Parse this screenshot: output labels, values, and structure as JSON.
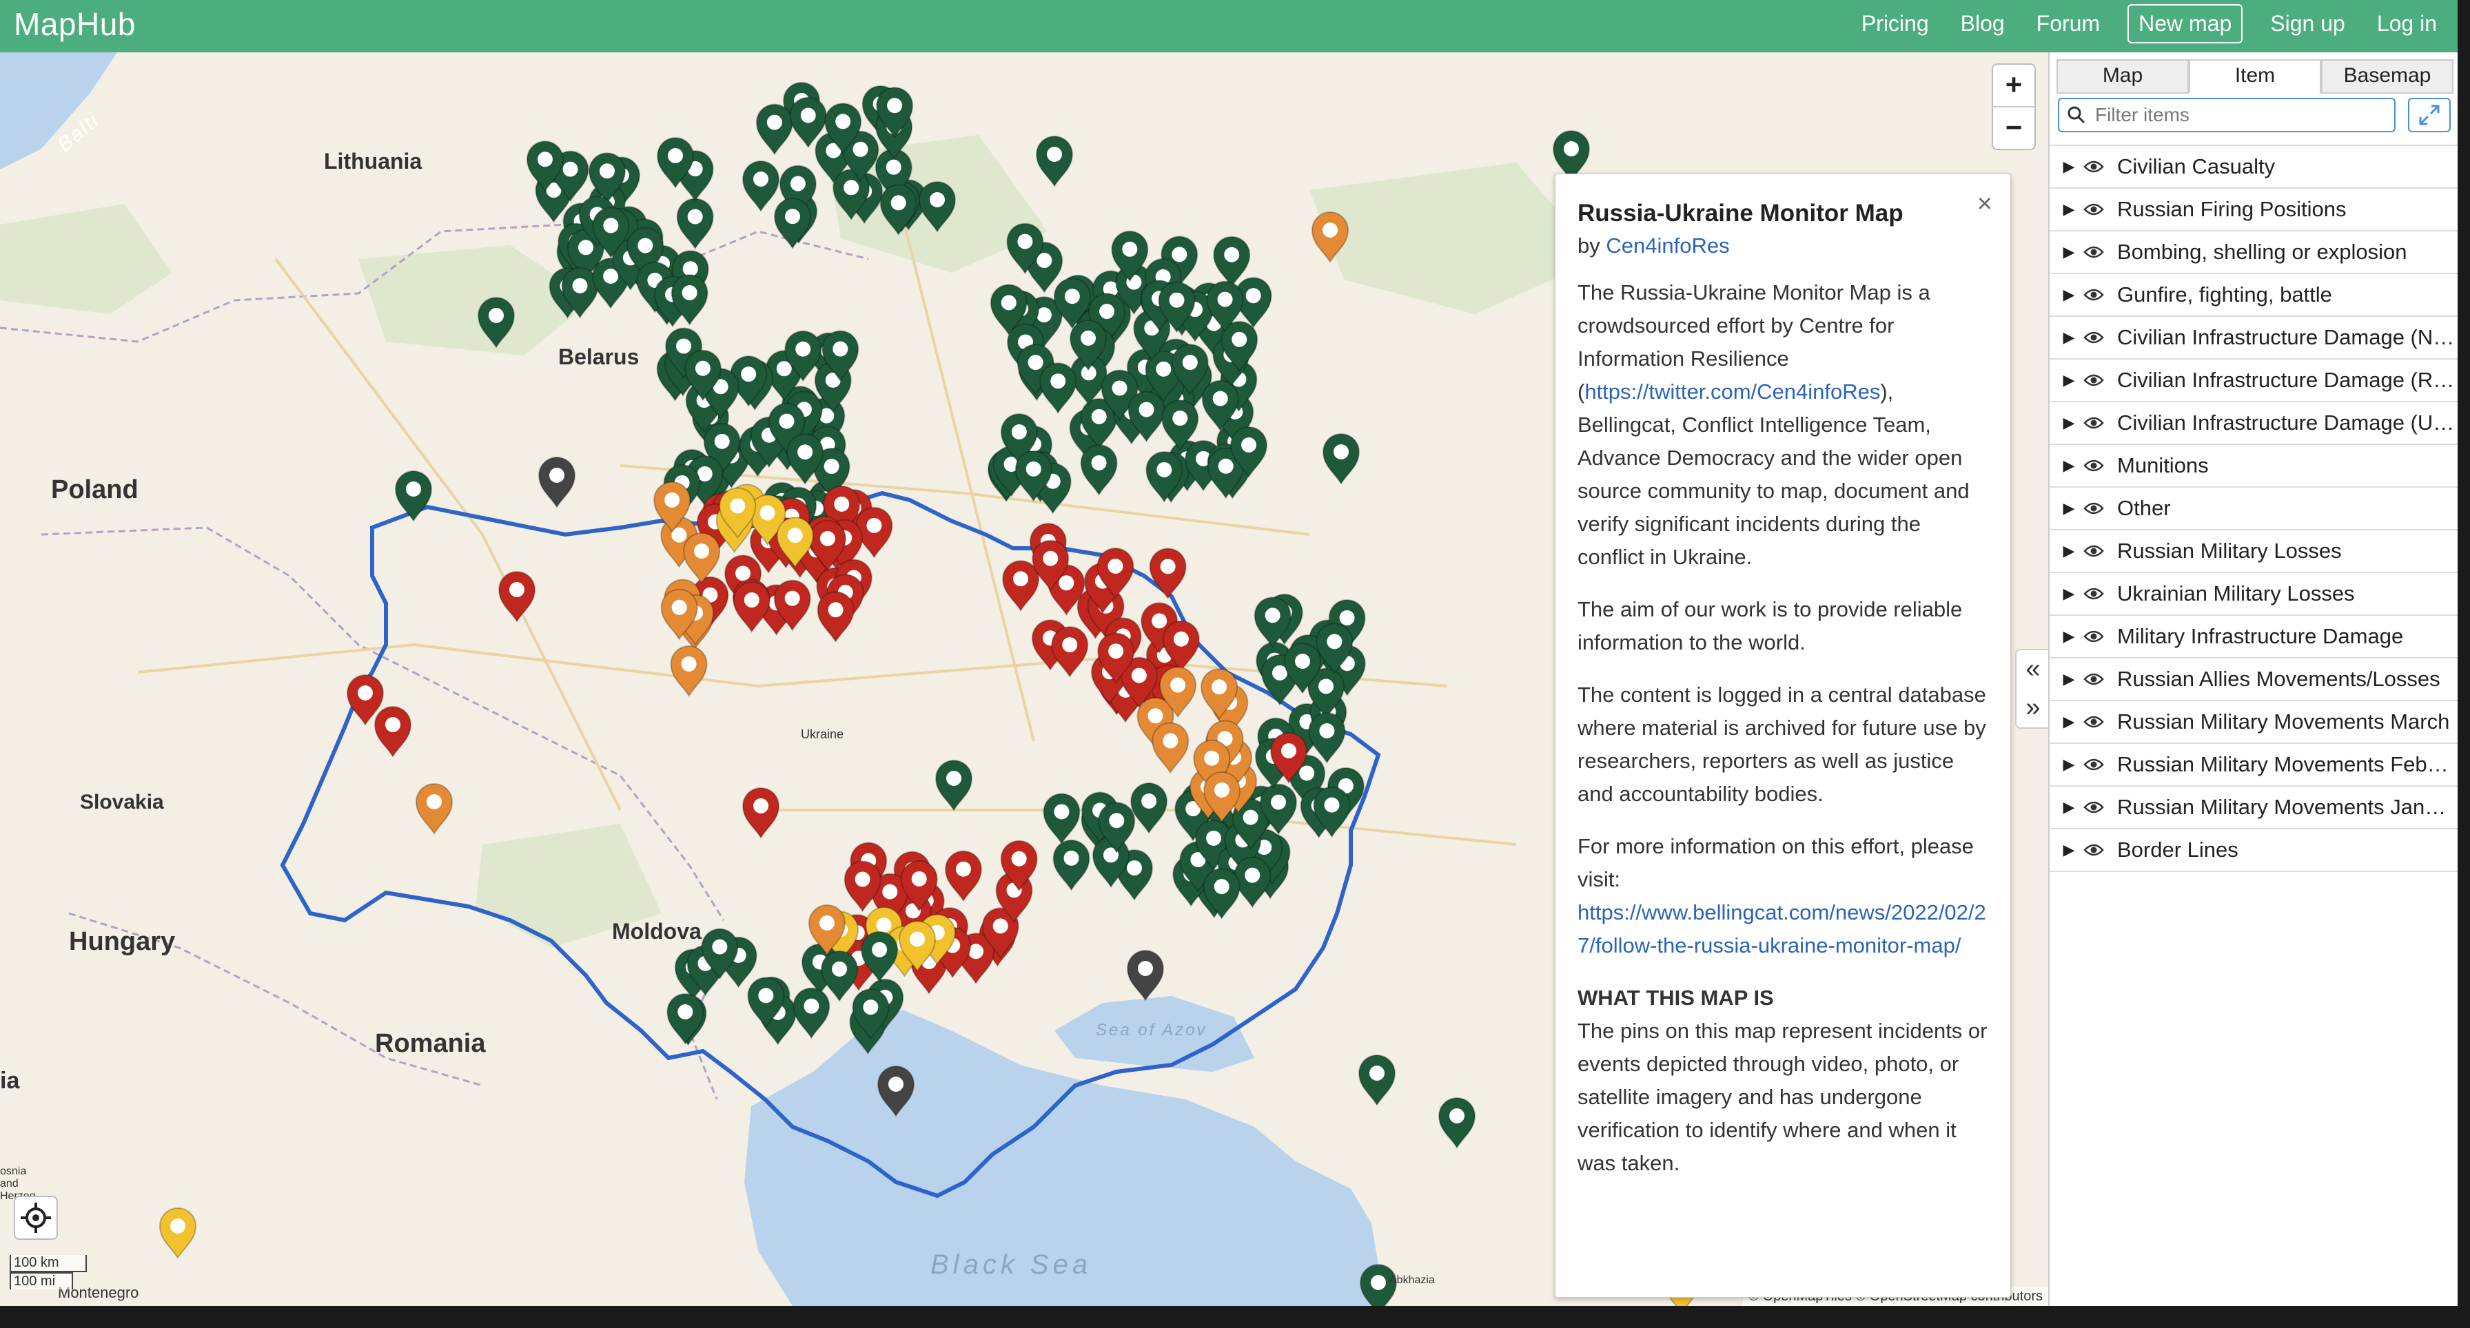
{
  "navbar": {
    "brand": "MapHub",
    "links": [
      "Pricing",
      "Blog",
      "Forum",
      "New map",
      "Sign up",
      "Log in"
    ]
  },
  "map": {
    "country_labels": [
      "Lithuania",
      "Belarus",
      "Poland",
      "Slovakia",
      "Hungary",
      "Moldova",
      "Romania",
      "Ukraine",
      "Montenegro",
      "Abkhazia",
      "Balti",
      "osnia and Herzeg",
      "ia"
    ],
    "sea_labels": [
      "Black Sea",
      "Sea of Azov"
    ],
    "zoom_in": "+",
    "zoom_out": "−",
    "scale_km": "100 km",
    "scale_mi": "100 mi",
    "attribution": "© OpenMapTiles © OpenStreetMap contributors"
  },
  "info": {
    "title": "Russia-Ukraine Monitor Map",
    "by_prefix": "by",
    "author": "Cen4infoRes",
    "close": "×",
    "p1_before": "The Russia-Ukraine Monitor Map is a crowdsourced effort by Centre for Information Resilience (",
    "p1_link": "https://twitter.com/Cen4infoRes",
    "p1_after": "), Bellingcat, Conflict Intelligence Team, Advance Democracy and the wider open source community to map, document and verify significant incidents during the conflict in Ukraine.",
    "p2": "The aim of our work is to provide reliable information to the world.",
    "p3": "The content is logged in a central database where material is archived for future use by researchers, reporters as well as justice and accountability bodies.",
    "p4": "For more information on this effort, please visit:",
    "p4_link": "https://www.bellingcat.com/news/2022/02/27/follow-the-russia-ukraine-monitor-map/",
    "heading": "What this map is",
    "p5": "The pins on this map represent incidents or events depicted through video, photo, or satellite imagery and has undergone verification to identify where and when it was taken."
  },
  "sidebar": {
    "tabs": [
      "Map",
      "Item",
      "Basemap"
    ],
    "active_tab": "Item",
    "filter_placeholder": "Filter items",
    "layers": [
      "Civilian Casualty",
      "Russian Firing Positions",
      "Bombing, shelling or explosion",
      "Gunfire, fighting, battle",
      "Civilian Infrastructure Damage (Non-Residential)",
      "Civilian Infrastructure Damage (Residential)",
      "Civilian Infrastructure Damage (Unknown)",
      "Munitions",
      "Other",
      "Russian Military Losses",
      "Ukrainian Military Losses",
      "Military Infrastructure Damage",
      "Russian Allies Movements/Losses",
      "Russian Military Movements March",
      "Russian Military Movements February",
      "Russian Military Movements January",
      "Border Lines"
    ]
  },
  "colors": {
    "navbar": "#4cae7f",
    "pin_green": "#1e5a3a",
    "pin_red": "#c0281f",
    "pin_orange": "#e58a34",
    "pin_yellow": "#f2c12e",
    "pin_dark": "#444444",
    "border_line": "#2e63c9",
    "water": "#b9d3ec",
    "link": "#2a64b8"
  }
}
